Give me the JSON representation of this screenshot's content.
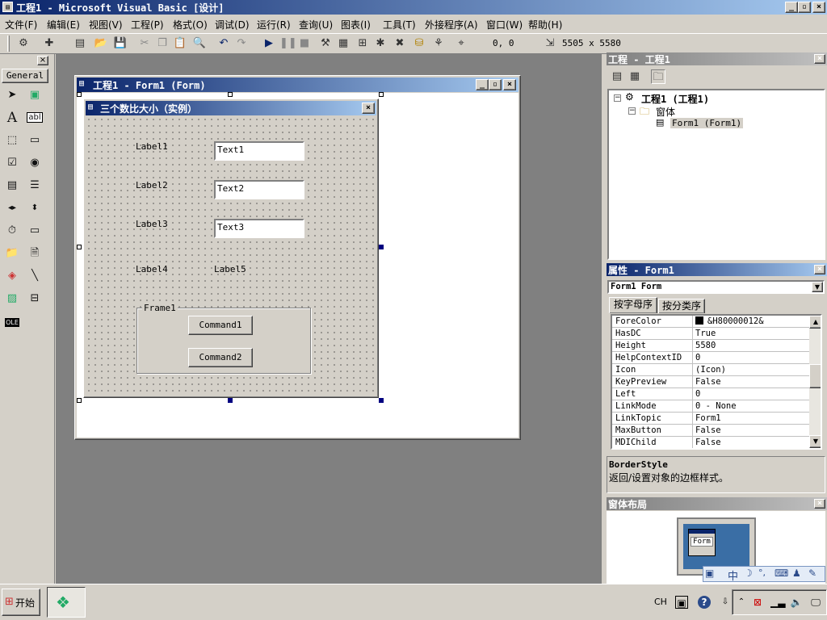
{
  "window": {
    "title": "工程1 - Microsoft Visual Basic [设计]",
    "min": "_",
    "max": "▫",
    "close": "×"
  },
  "menu": [
    "文件(F)",
    "编辑(E)",
    "视图(V)",
    "工程(P)",
    "格式(O)",
    "调试(D)",
    "运行(R)",
    "查询(U)",
    "图表(I)",
    "工具(T)",
    "外接程序(A)",
    "窗口(W)",
    "帮助(H)"
  ],
  "toolbar": {
    "position": "0, 0",
    "size": "5505 x 5580"
  },
  "toolbox": {
    "tab": "General"
  },
  "designer": {
    "title": "工程1 - Form1 (Form)"
  },
  "form": {
    "caption": "三个数比大小（实例）",
    "labels": [
      "Label1",
      "Label2",
      "Label3",
      "Label4",
      "Label5"
    ],
    "texts": [
      "Text1",
      "Text2",
      "Text3"
    ],
    "frame": "Frame1",
    "commands": [
      "Command1",
      "Command2"
    ]
  },
  "project": {
    "title": "工程 - 工程1",
    "root": "工程1 (工程1)",
    "folder": "窗体",
    "item": "Form1 (Form1)"
  },
  "properties": {
    "title": "属性 - Form1",
    "object": "Form1 Form",
    "tabs": [
      "按字母序",
      "按分类序"
    ],
    "rows": [
      {
        "name": "ForeColor",
        "value": "&H80000012&"
      },
      {
        "name": "HasDC",
        "value": "True"
      },
      {
        "name": "Height",
        "value": "5580"
      },
      {
        "name": "HelpContextID",
        "value": "0"
      },
      {
        "name": "Icon",
        "value": "(Icon)"
      },
      {
        "name": "KeyPreview",
        "value": "False"
      },
      {
        "name": "Left",
        "value": "0"
      },
      {
        "name": "LinkMode",
        "value": "0 - None"
      },
      {
        "name": "LinkTopic",
        "value": "Form1"
      },
      {
        "name": "MaxButton",
        "value": "False"
      },
      {
        "name": "MDIChild",
        "value": "False"
      }
    ],
    "desc_title": "BorderStyle",
    "desc_text": "返回/设置对象的边框样式。"
  },
  "layout": {
    "title": "窗体布局",
    "thumb": "Form"
  },
  "taskbar": {
    "start": "开始",
    "lang": "CH",
    "ime": "中"
  },
  "colors": {
    "titlebar": "#0a246a",
    "desktop": "#808080",
    "panelbg": "#d4d0c8"
  }
}
